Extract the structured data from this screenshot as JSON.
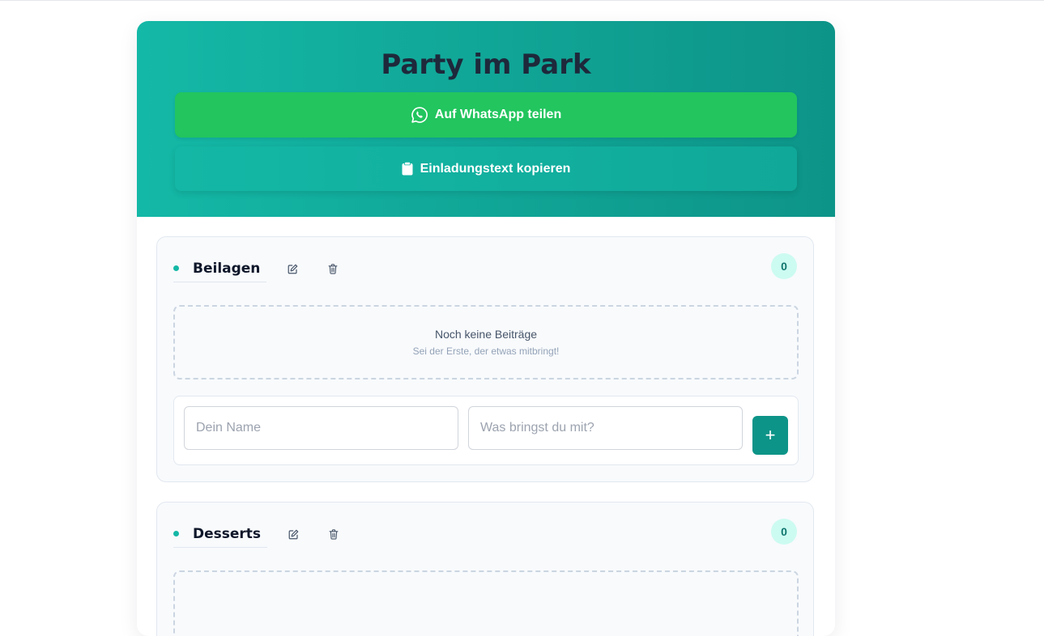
{
  "event": {
    "title": "Party im Park"
  },
  "actions": {
    "share_label": "Auf WhatsApp teilen",
    "copy_label": "Einladungstext kopieren"
  },
  "categories": [
    {
      "title": "Beilagen",
      "count": "0",
      "empty_title": "Noch keine Beiträge",
      "empty_subtitle": "Sei der Erste, der etwas mitbringt!",
      "name_placeholder": "Dein Name",
      "item_placeholder": "Was bringst du mit?",
      "add_label": "+"
    },
    {
      "title": "Desserts",
      "count": "0"
    }
  ],
  "colors": {
    "accent": "#14b8a6",
    "accent_dark": "#0d9488",
    "whatsapp": "#22c55e"
  },
  "icons": {
    "share": "whatsapp-icon",
    "copy": "clipboard-icon",
    "edit": "edit-icon",
    "delete": "trash-icon"
  }
}
